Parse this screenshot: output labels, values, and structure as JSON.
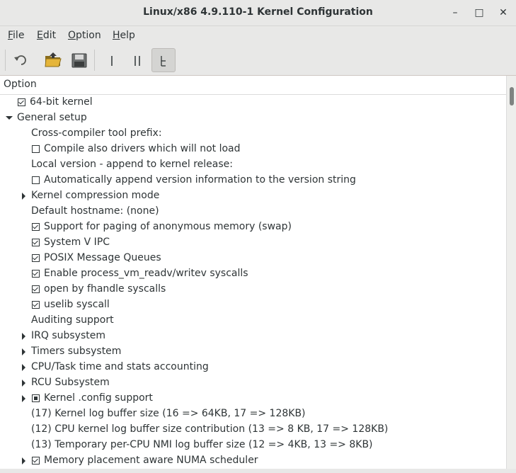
{
  "window": {
    "title": "Linux/x86 4.9.110-1 Kernel Configuration",
    "minimize": "–",
    "maximize": "□",
    "close": "✕"
  },
  "menubar": {
    "file": {
      "pre": "",
      "u": "F",
      "post": "ile"
    },
    "edit": {
      "pre": "",
      "u": "E",
      "post": "dit"
    },
    "option": {
      "pre": "",
      "u": "O",
      "post": "ption"
    },
    "help": {
      "pre": "",
      "u": "H",
      "post": "elp"
    }
  },
  "toolbar": {
    "icons": [
      "undo-icon",
      "open-folder-icon",
      "save-icon",
      "single-view-icon",
      "split-view-icon",
      "full-tree-view-icon"
    ]
  },
  "tree": {
    "header": "Option",
    "rows": [
      {
        "label": "64-bit kernel",
        "check": "checked"
      },
      {
        "label": "General setup",
        "expander": "down"
      },
      {
        "label": "Cross-compiler tool prefix:"
      },
      {
        "label": "Compile also drivers which will not load",
        "check": "unchecked"
      },
      {
        "label": "Local version - append to kernel release:"
      },
      {
        "label": "Automatically append version information to the version string",
        "check": "unchecked"
      },
      {
        "label": "Kernel compression mode",
        "expander": "right"
      },
      {
        "label": "Default hostname: (none)"
      },
      {
        "label": "Support for paging of anonymous memory (swap)",
        "check": "checked"
      },
      {
        "label": "System V IPC",
        "check": "checked"
      },
      {
        "label": "POSIX Message Queues",
        "check": "checked"
      },
      {
        "label": "Enable process_vm_readv/writev syscalls",
        "check": "checked"
      },
      {
        "label": "open by fhandle syscalls",
        "check": "checked"
      },
      {
        "label": "uselib syscall",
        "check": "checked"
      },
      {
        "label": "Auditing support"
      },
      {
        "label": "IRQ subsystem",
        "expander": "right"
      },
      {
        "label": "Timers subsystem",
        "expander": "right"
      },
      {
        "label": "CPU/Task time and stats accounting",
        "expander": "right"
      },
      {
        "label": "RCU Subsystem",
        "expander": "right"
      },
      {
        "label": "Kernel .config support",
        "expander": "right",
        "check": "module"
      },
      {
        "label": "(17) Kernel log buffer size (16 => 64KB, 17 => 128KB)"
      },
      {
        "label": "(12) CPU kernel log buffer size contribution (13 => 8 KB, 17 => 128KB)"
      },
      {
        "label": "(13) Temporary per-CPU NMI log buffer size (12 => 4KB, 13 => 8KB)"
      },
      {
        "label": "Memory placement aware NUMA scheduler",
        "expander": "right",
        "check": "checked"
      }
    ]
  },
  "colors": {
    "window_bg": "#e8e8e7",
    "list_bg": "#ffffff",
    "text": "#2e3436",
    "scroll_thumb": "#7f8381"
  }
}
